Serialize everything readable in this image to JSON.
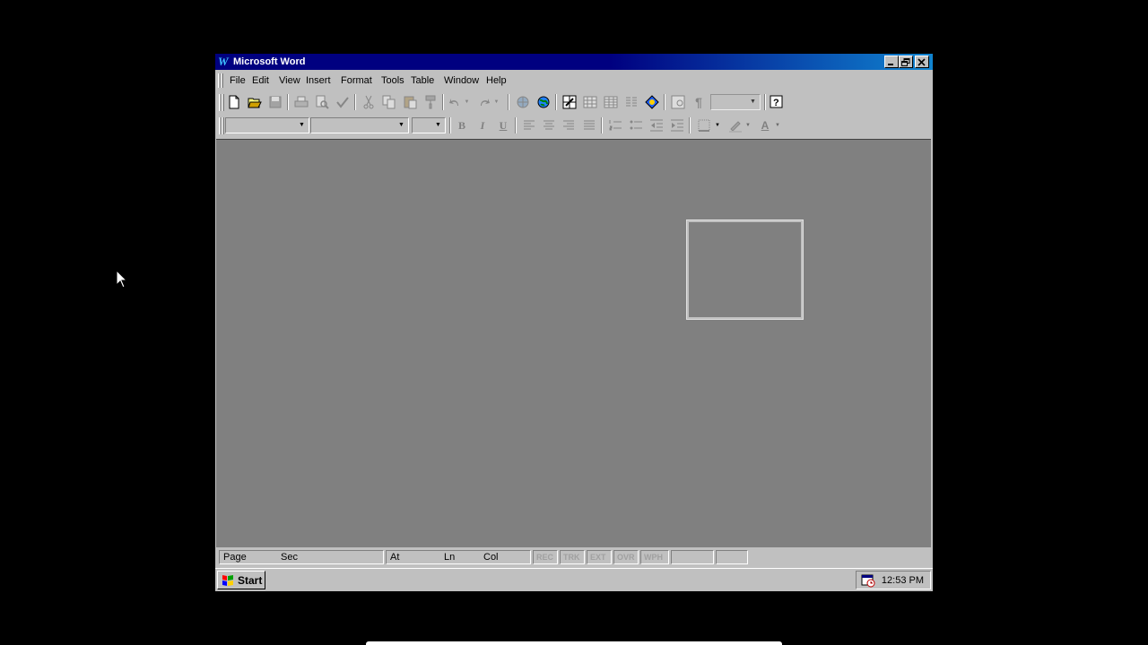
{
  "window": {
    "title": "Microsoft Word",
    "app_icon": "W"
  },
  "menu": [
    {
      "label": "File"
    },
    {
      "label": "Edit"
    },
    {
      "label": "View"
    },
    {
      "label": "Insert"
    },
    {
      "label": "Format"
    },
    {
      "label": "Tools"
    },
    {
      "label": "Table"
    },
    {
      "label": "Window"
    },
    {
      "label": "Help"
    }
  ],
  "formatting": {
    "bold": "B",
    "italic": "I",
    "underline": "U",
    "font_color": "A"
  },
  "statusbar": {
    "page": "Page",
    "sec": "Sec",
    "at": "At",
    "ln": "Ln",
    "col": "Col",
    "modes": [
      "REC",
      "TRK",
      "EXT",
      "OVR",
      "WPH"
    ]
  },
  "taskbar": {
    "start_label": "Start",
    "clock": "12:53 PM"
  },
  "colors": {
    "titlebar": "#000080",
    "workspace": "#808080",
    "chrome": "#c0c0c0",
    "desktop": "#000000"
  }
}
